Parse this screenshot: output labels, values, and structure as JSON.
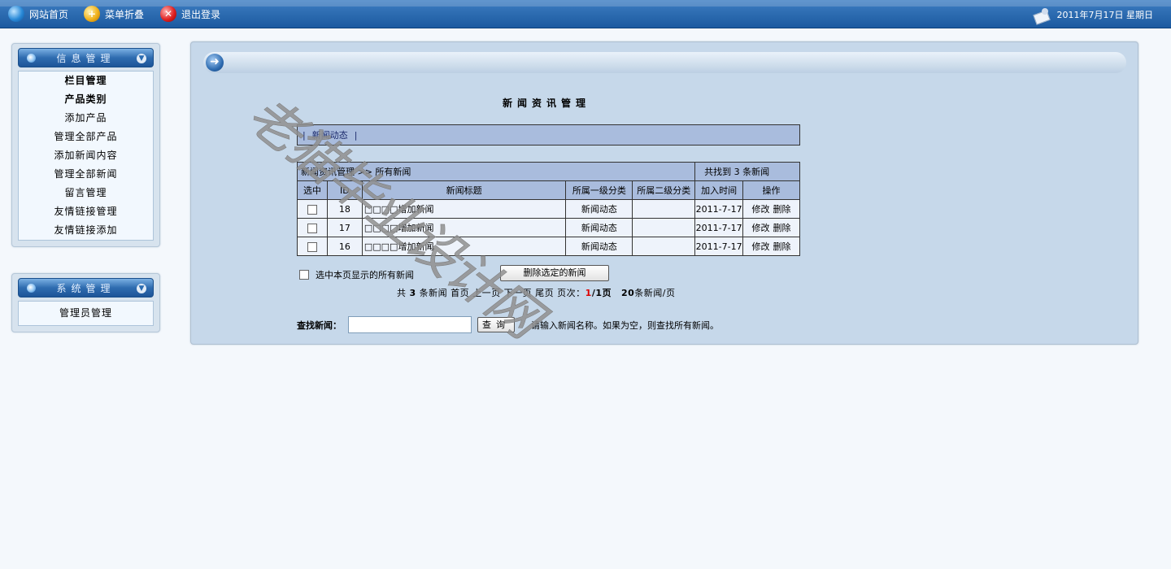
{
  "topbar": {
    "home_label": "网站首页",
    "fold_label": "菜单折叠",
    "logout_label": "退出登录",
    "date_text": "2011年7月17日 星期日"
  },
  "sidebar": {
    "info_panel": {
      "title": "信息管理",
      "items": [
        {
          "label": "栏目管理"
        },
        {
          "label": "产品类别"
        },
        {
          "label": "添加产品"
        },
        {
          "label": "管理全部产品"
        },
        {
          "label": "添加新闻内容"
        },
        {
          "label": "管理全部新闻"
        },
        {
          "label": "留言管理"
        },
        {
          "label": "友情链接管理"
        },
        {
          "label": "友情链接添加"
        }
      ]
    },
    "system_panel": {
      "title": "系统管理",
      "items": [
        {
          "label": "管理员管理"
        }
      ]
    }
  },
  "main": {
    "page_title": "新闻资讯管理",
    "tabs": {
      "sep_left": "|",
      "tab1": "新闻动态",
      "sep_right": "|"
    },
    "table": {
      "breadcrumb": "新闻资讯管理 >> 所有新闻",
      "found_text": "共找到 3 条新闻",
      "headers": {
        "select": "选中",
        "id": "ID",
        "title": "新闻标题",
        "cat1": "所属一级分类",
        "cat2": "所属二级分类",
        "time": "加入时间",
        "ops": "操作"
      },
      "rows": [
        {
          "id": "18",
          "title": "□□□□增加新闻",
          "cat1": "新闻动态",
          "cat2": "",
          "time": "2011-7-17",
          "edit": "修改",
          "del": "删除"
        },
        {
          "id": "17",
          "title": "□□□□增加新闻",
          "cat1": "新闻动态",
          "cat2": "",
          "time": "2011-7-17",
          "edit": "修改",
          "del": "删除"
        },
        {
          "id": "16",
          "title": "□□□□增加新闻",
          "cat1": "新闻动态",
          "cat2": "",
          "time": "2011-7-17",
          "edit": "修改",
          "del": "删除"
        }
      ]
    },
    "select_all_label": "选中本页显示的所有新闻",
    "delete_button": "删除选定的新闻",
    "pager": {
      "prefix": "共",
      "total": "3",
      "unit": "条新闻",
      "first": "首页",
      "prev": "上一页",
      "next": "下一页",
      "last": "尾页",
      "page_label": "页次：",
      "current": "1",
      "total_pages": "/1页",
      "per_page": "20",
      "per_page_unit": "条新闻/页"
    },
    "search": {
      "label": "查找新闻：",
      "value": "",
      "button": "查询",
      "hint": "请输入新闻名称。如果为空，则查找所有新闻。"
    }
  },
  "watermark": {
    "text": "老猫毕业设计网"
  },
  "colors": {
    "topbar": "#2e6db2",
    "panel_bg": "#c6d8ea",
    "table_header": "#a9bcdd",
    "row_bg": "#eef3fb",
    "page_bg": "#f4f8fc"
  }
}
